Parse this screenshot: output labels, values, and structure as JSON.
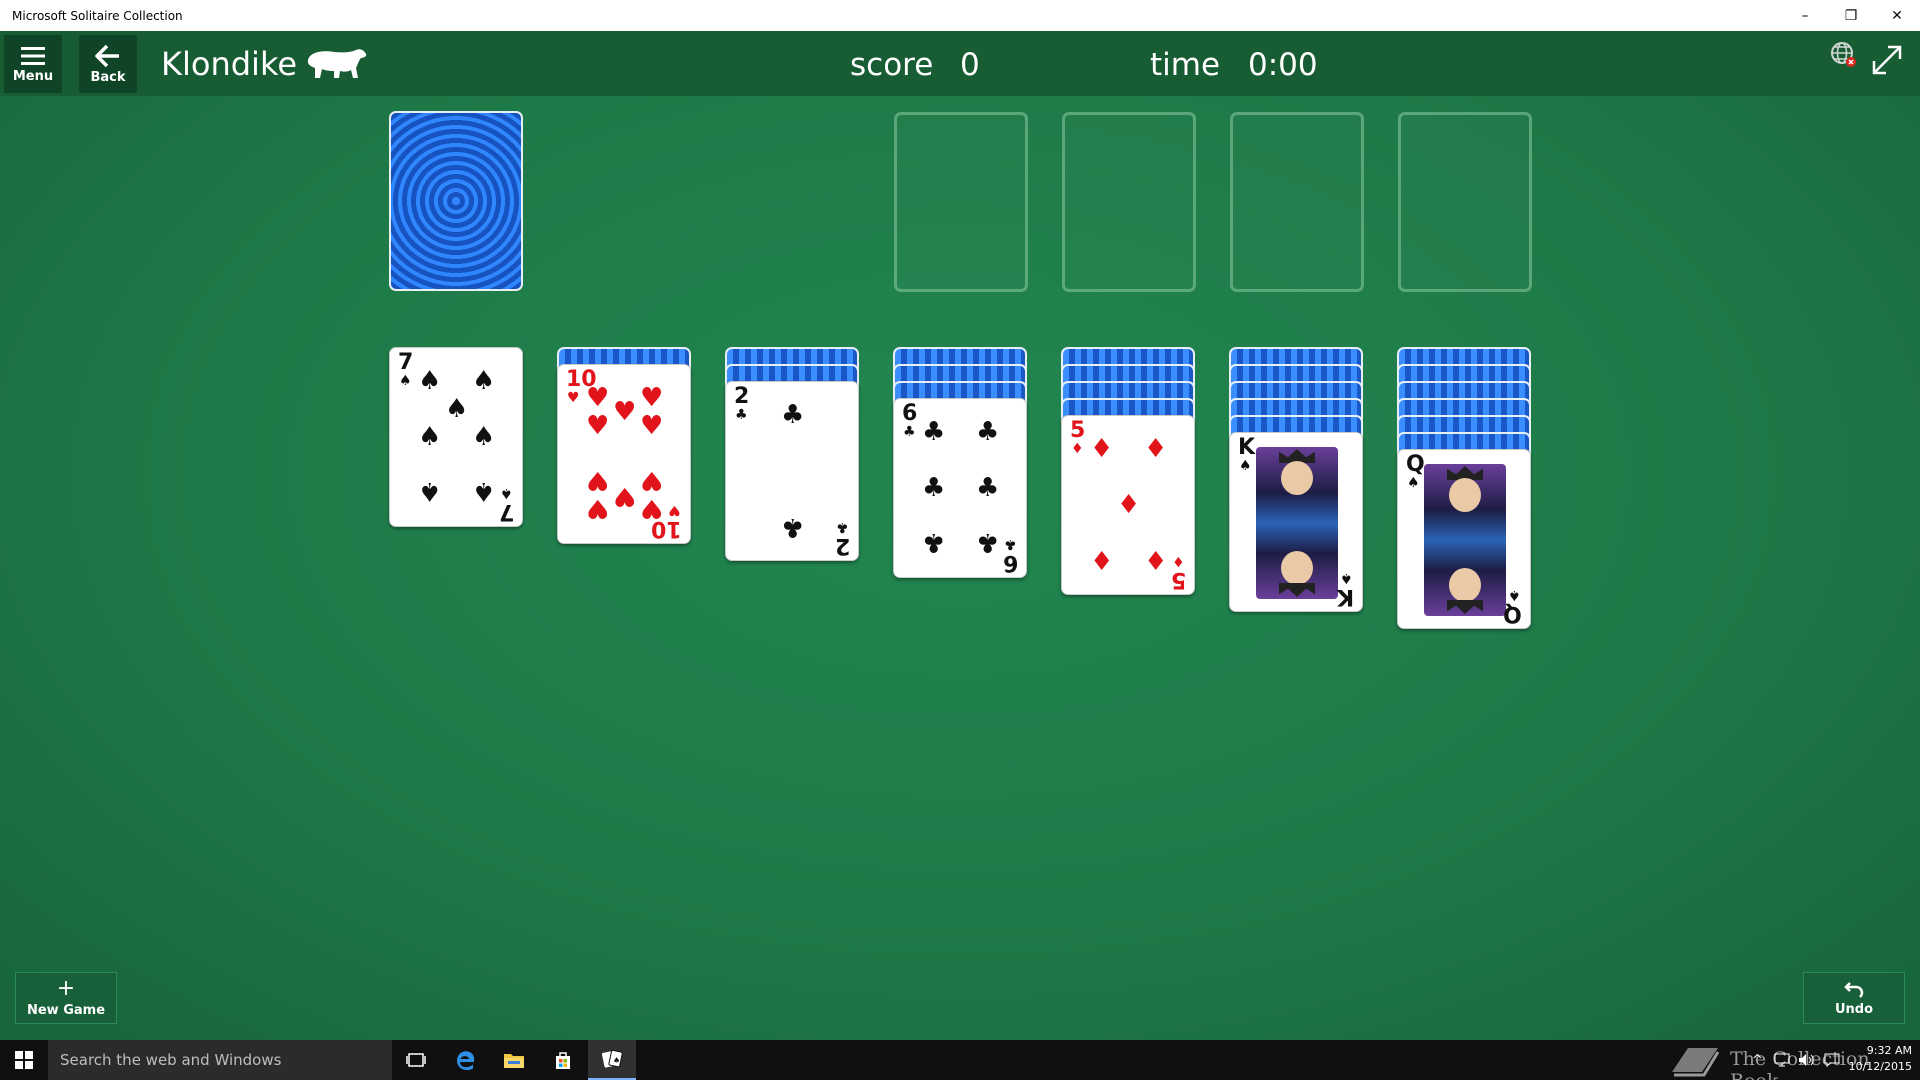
{
  "window": {
    "title": "Microsoft Solitaire Collection",
    "minimize": "–",
    "restore": "❐",
    "close": "✕"
  },
  "header": {
    "menu_label": "Menu",
    "back_label": "Back",
    "game_title": "Klondike",
    "score_label": "score",
    "score_value": "0",
    "time_label": "time",
    "time_value": "0:00"
  },
  "tableau": [
    {
      "rank": "7",
      "suit": "♠",
      "color": "black",
      "face_down": 0
    },
    {
      "rank": "10",
      "suit": "♥",
      "color": "red",
      "face_down": 1
    },
    {
      "rank": "2",
      "suit": "♣",
      "color": "black",
      "face_down": 2
    },
    {
      "rank": "6",
      "suit": "♣",
      "color": "black",
      "face_down": 3
    },
    {
      "rank": "5",
      "suit": "♦",
      "color": "red",
      "face_down": 4
    },
    {
      "rank": "K",
      "suit": "♠",
      "color": "black",
      "face_down": 5
    },
    {
      "rank": "Q",
      "suit": "♠",
      "color": "black",
      "face_down": 6
    }
  ],
  "foundations": 4,
  "footer": {
    "new_game_label": "New Game",
    "undo_label": "Undo"
  },
  "taskbar": {
    "search_placeholder": "Search the web and Windows",
    "clock_time": "9:32 AM",
    "clock_date": "10/12/2015",
    "watermark": "The Collection Book"
  },
  "colors": {
    "felt": "#1f7a46",
    "header": "#185c34",
    "card_back": "#1a66d8",
    "red_suit": "#e1141b"
  }
}
